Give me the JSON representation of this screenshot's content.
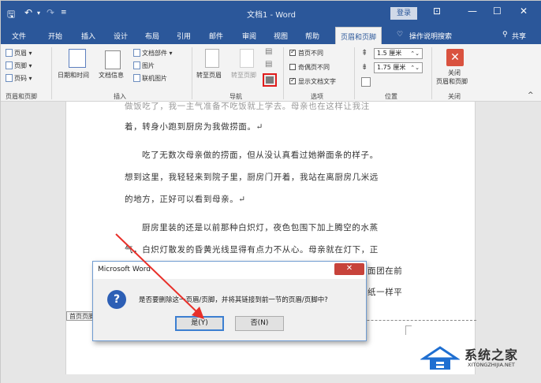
{
  "titlebar": {
    "doc_title": "文档1  -  Word",
    "login": "登录",
    "save_icon": "save-icon",
    "undo_icon": "undo-icon",
    "redo_icon": "redo-icon"
  },
  "tabs": [
    "文件",
    "开始",
    "插入",
    "设计",
    "布局",
    "引用",
    "邮件",
    "审阅",
    "视图",
    "帮助",
    "页眉和页脚",
    "操作说明搜索",
    "共享"
  ],
  "ribbon": {
    "header": "页眉 ▾",
    "footer": "页脚 ▾",
    "page_number": "页码 ▾",
    "hf_group": "页眉和页脚",
    "datetime": "日期和时间",
    "docinfo": "文档信息",
    "docparts": "文档部件 ▾",
    "picture": "图片",
    "online_picture": "联机图片",
    "insert_group": "插入",
    "goto_header": "转至页眉",
    "goto_footer": "转至页脚",
    "nav_group": "导航",
    "first_page_diff": "首页不同",
    "odd_even_diff": "奇偶页不同",
    "show_doc_text": "显示文档文字",
    "options_group": "选项",
    "header_pos": "1.5 厘米",
    "footer_pos": "1.75 厘米",
    "position_group": "位置",
    "close_label_1": "关闭",
    "close_label_2": "页眉和页脚",
    "close_group": "关闭",
    "collapse": "^"
  },
  "document": {
    "lines": [
      "做饭吃了，我一主气准备不吃饭就上学去。母亲也在这样让我注",
      "着，转身小跑到厨房为我做捞面。↵",
      "吃了无数次母亲做的捞面，但从没认真看过她擀面条的样子。",
      "想到这里，我轻轻来到院子里，厨房门开着，我站在离厨房几米远",
      "的地方，正好可以看到母亲。↵",
      "厨房里装的还是以前那种白炽灯，夜色包围下加上腾空的水蒸",
      "气，白炽灯散发的昏黄光线显得有点力不从心。母亲就在灯下，正",
      "面团在前",
      "纸一样平"
    ],
    "hf_tag": "首页页脚"
  },
  "dialog": {
    "title": "Microsoft Word",
    "close": "✕",
    "message": "是否要删除这一页眉/页脚，并将其链接到前一节的页眉/页脚中?",
    "yes": "是(Y)",
    "no": "否(N)"
  },
  "watermark": {
    "name": "系统之家",
    "url": "XITONGZHIJIA.NET"
  }
}
